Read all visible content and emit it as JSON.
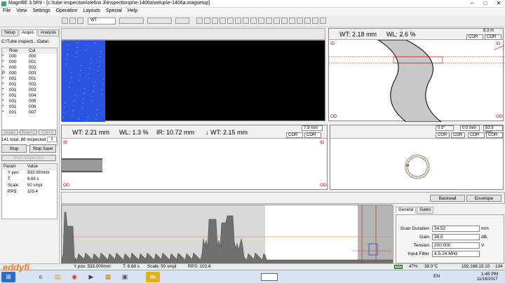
{
  "window": {
    "title": "MagnifiE 3.5R9 - [c:\\tube inspection\\olefins 3\\inspectionpr\\e-1406a\\setup\\e-1406a.magsetup]"
  },
  "menu": [
    "File",
    "View",
    "Settings",
    "Operation",
    "Layouts",
    "Special",
    "Help"
  ],
  "toolbar": {
    "wt_label": "WT"
  },
  "left_panel": {
    "tabs": [
      "Setup",
      "Acquis",
      "Analysis"
    ],
    "path": "C:\\Tube inspecti...\\Data\\",
    "columns": [
      "",
      "Row",
      "Col"
    ],
    "rows": [
      {
        "m": "*",
        "row": "000",
        "col": "000"
      },
      {
        "m": "*",
        "row": "000",
        "col": "001"
      },
      {
        "m": "*",
        "row": "000",
        "col": "002"
      },
      {
        "m": "P",
        "row": "000",
        "col": "003"
      },
      {
        "m": "*",
        "row": "001",
        "col": "001"
      },
      {
        "m": "*",
        "row": "001",
        "col": "002"
      },
      {
        "m": "*",
        "row": "001",
        "col": "003"
      },
      {
        "m": "*",
        "row": "001",
        "col": "004"
      },
      {
        "m": "*",
        "row": "001",
        "col": "005"
      },
      {
        "m": "*",
        "row": "001",
        "col": "006"
      },
      {
        "m": "*",
        "row": "001",
        "col": "007"
      }
    ],
    "insert_label": "Insert",
    "row_plus_label": "Row+1",
    "col_plus_label": "Col+1",
    "summary": "141 total, 86 inspected",
    "summary_num": "1",
    "stop_label": "Stop",
    "stop_save_label": "Stop Save",
    "start_label": "Start Inspection",
    "param_header": "Param",
    "value_header": "Value",
    "params": [
      {
        "name": "Y pos:",
        "value": "533.000mm"
      },
      {
        "name": "T:",
        "value": "6.68 s"
      },
      {
        "name": "Scale:",
        "value": "50 smpl"
      },
      {
        "name": "RPS:",
        "value": "103.4"
      }
    ]
  },
  "top_right": {
    "wt": "WT: 2.18 mm",
    "wl": "WL: 2.6 %",
    "value": "8.3 m",
    "cor1": "COR",
    "cor2": "COR",
    "id_label": "ID",
    "od_label": "OD"
  },
  "middle": {
    "wt": "WT: 2.21 mm",
    "wl": "WL: 1.3 %",
    "ir": "IR: 10.72 mm",
    "wt2": "↓ WT: 2.15 mm",
    "range": "7.9 mm",
    "cor1": "COR",
    "cor2": "COR",
    "id_label": "ID",
    "od_label": "OD"
  },
  "middle_right": {
    "angle": "0.0°",
    "v1": "0.0 mm",
    "v2": "53.5 mm",
    "cor1": "COR",
    "cor2": "COR",
    "cor3": "COR",
    "cor4": "COR"
  },
  "bottom": {
    "backwall_label": "Backwall",
    "envelope_label": "Envelope"
  },
  "settings": {
    "tabs": [
      "General",
      "Gates"
    ],
    "fields": [
      {
        "label": "Scan Duration",
        "value": "34.52",
        "unit": "mm"
      },
      {
        "label": "Gain",
        "value": "38.0",
        "unit": "dB"
      },
      {
        "label": "Tension",
        "value": "200.000",
        "unit": "V"
      },
      {
        "label": "Input Filter",
        "value": "4.5-24 MHz",
        "unit": ""
      }
    ]
  },
  "statusbar": {
    "ypos": "Y pos: 533.000mm",
    "t": "T: 6.68 s",
    "scale": "Scale: 50 smpl",
    "rps": "RPS: 103.4",
    "pct": "47%",
    "temp": "38.0°C",
    "ip": "192.168.19.10",
    "num": "134"
  },
  "taskbar": {
    "brand": "eddyfi",
    "lang": "EN",
    "time": "1:45 PM",
    "date": "11/16/2017"
  },
  "colors": {
    "cscan_blue": "#2b55e0",
    "grey_plot": "#808080",
    "red_gate": "#cc0000",
    "orange_line": "#e8a040",
    "brand_orange": "#f08020"
  }
}
